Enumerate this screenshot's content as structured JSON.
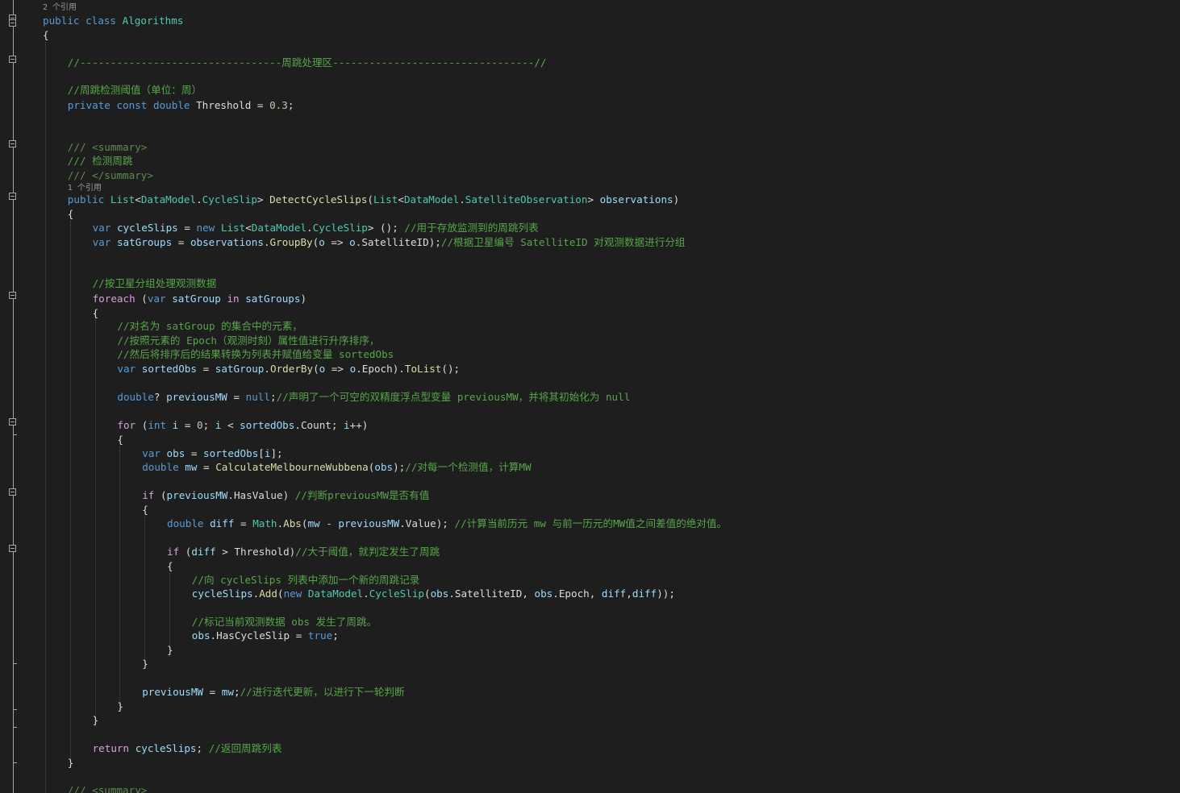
{
  "editor": {
    "codelens": [
      {
        "text": "2 个引用"
      },
      {
        "text": "1 个引用"
      }
    ],
    "lines": [
      {
        "tokens": [
          {
            "t": "public",
            "c": "kw"
          },
          {
            "t": " "
          },
          {
            "t": "class",
            "c": "kw"
          },
          {
            "t": " "
          },
          {
            "t": "Algorithms",
            "c": "typ"
          }
        ]
      },
      {
        "tokens": [
          {
            "t": "{"
          }
        ]
      },
      {
        "tokens": [
          {
            "t": "//---------------------------------周跳处理区---------------------------------//",
            "c": "cm"
          }
        ]
      },
      {
        "tokens": [
          {
            "t": "//周跳检测阈值（单位：周）",
            "c": "cm"
          }
        ]
      },
      {
        "tokens": [
          {
            "t": "private",
            "c": "kw"
          },
          {
            "t": " "
          },
          {
            "t": "const",
            "c": "kw"
          },
          {
            "t": " "
          },
          {
            "t": "double",
            "c": "kw"
          },
          {
            "t": " Threshold = "
          },
          {
            "t": "0.3",
            "c": "num"
          },
          {
            "t": ";"
          }
        ]
      },
      {
        "tokens": [
          {
            "t": "/// <summary>",
            "c": "xml"
          }
        ]
      },
      {
        "tokens": [
          {
            "t": "/// 检测周跳",
            "c": "cm"
          }
        ]
      },
      {
        "tokens": [
          {
            "t": "/// </summary>",
            "c": "xml"
          }
        ]
      },
      {
        "tokens": [
          {
            "t": "public",
            "c": "kw"
          },
          {
            "t": " "
          },
          {
            "t": "List",
            "c": "typ"
          },
          {
            "t": "<"
          },
          {
            "t": "DataModel",
            "c": "typ"
          },
          {
            "t": "."
          },
          {
            "t": "CycleSlip",
            "c": "typ"
          },
          {
            "t": "> "
          },
          {
            "t": "DetectCycleSlips",
            "c": "mth"
          },
          {
            "t": "("
          },
          {
            "t": "List",
            "c": "typ"
          },
          {
            "t": "<"
          },
          {
            "t": "DataModel",
            "c": "typ"
          },
          {
            "t": "."
          },
          {
            "t": "SatelliteObservation",
            "c": "typ"
          },
          {
            "t": "> "
          },
          {
            "t": "observations",
            "c": "vr"
          },
          {
            "t": ")"
          }
        ]
      },
      {
        "tokens": [
          {
            "t": "{"
          }
        ]
      },
      {
        "tokens": [
          {
            "t": "var",
            "c": "kw"
          },
          {
            "t": " "
          },
          {
            "t": "cycleSlips",
            "c": "vr"
          },
          {
            "t": " = "
          },
          {
            "t": "new",
            "c": "kw"
          },
          {
            "t": " "
          },
          {
            "t": "List",
            "c": "typ"
          },
          {
            "t": "<"
          },
          {
            "t": "DataModel",
            "c": "typ"
          },
          {
            "t": "."
          },
          {
            "t": "CycleSlip",
            "c": "typ"
          },
          {
            "t": "> (); "
          },
          {
            "t": "//用于存放监测到的周跳列表",
            "c": "cm"
          }
        ]
      },
      {
        "tokens": [
          {
            "t": "var",
            "c": "kw"
          },
          {
            "t": " "
          },
          {
            "t": "satGroups",
            "c": "vr"
          },
          {
            "t": " = "
          },
          {
            "t": "observations",
            "c": "vr"
          },
          {
            "t": "."
          },
          {
            "t": "GroupBy",
            "c": "mth"
          },
          {
            "t": "("
          },
          {
            "t": "o",
            "c": "vr"
          },
          {
            "t": " => "
          },
          {
            "t": "o",
            "c": "vr"
          },
          {
            "t": ".SatelliteID);"
          },
          {
            "t": "//根据卫星编号 SatelliteID 对观测数据进行分组",
            "c": "cm"
          }
        ]
      },
      {
        "tokens": [
          {
            "t": "//按卫星分组处理观测数据",
            "c": "cm"
          }
        ]
      },
      {
        "tokens": [
          {
            "t": "foreach",
            "c": "ctl"
          },
          {
            "t": " ("
          },
          {
            "t": "var",
            "c": "kw"
          },
          {
            "t": " "
          },
          {
            "t": "satGroup",
            "c": "vr"
          },
          {
            "t": " "
          },
          {
            "t": "in",
            "c": "ctl"
          },
          {
            "t": " "
          },
          {
            "t": "satGroups",
            "c": "vr"
          },
          {
            "t": ")"
          }
        ]
      },
      {
        "tokens": [
          {
            "t": "{"
          }
        ]
      },
      {
        "tokens": [
          {
            "t": "//对名为 satGroup 的集合中的元素，",
            "c": "cm"
          }
        ]
      },
      {
        "tokens": [
          {
            "t": "//按照元素的 Epoch（观测时刻）属性值进行升序排序，",
            "c": "cm"
          }
        ]
      },
      {
        "tokens": [
          {
            "t": "//然后将排序后的结果转换为列表并赋值给变量 sortedObs",
            "c": "cm"
          }
        ]
      },
      {
        "tokens": [
          {
            "t": "var",
            "c": "kw"
          },
          {
            "t": " "
          },
          {
            "t": "sortedObs",
            "c": "vr"
          },
          {
            "t": " = "
          },
          {
            "t": "satGroup",
            "c": "vr"
          },
          {
            "t": "."
          },
          {
            "t": "OrderBy",
            "c": "mth"
          },
          {
            "t": "("
          },
          {
            "t": "o",
            "c": "vr"
          },
          {
            "t": " => "
          },
          {
            "t": "o",
            "c": "vr"
          },
          {
            "t": ".Epoch)."
          },
          {
            "t": "ToList",
            "c": "mth"
          },
          {
            "t": "();"
          }
        ]
      },
      {
        "tokens": [
          {
            "t": "double",
            "c": "kw"
          },
          {
            "t": "? "
          },
          {
            "t": "previousMW",
            "c": "vr"
          },
          {
            "t": " = "
          },
          {
            "t": "null",
            "c": "kw"
          },
          {
            "t": ";"
          },
          {
            "t": "//声明了一个可空的双精度浮点型变量 previousMW，并将其初始化为 null",
            "c": "cm"
          }
        ]
      },
      {
        "tokens": [
          {
            "t": "for",
            "c": "ctl"
          },
          {
            "t": " ("
          },
          {
            "t": "int",
            "c": "kw"
          },
          {
            "t": " "
          },
          {
            "t": "i",
            "c": "vr"
          },
          {
            "t": " = "
          },
          {
            "t": "0",
            "c": "num"
          },
          {
            "t": "; "
          },
          {
            "t": "i",
            "c": "vr"
          },
          {
            "t": " < "
          },
          {
            "t": "sortedObs",
            "c": "vr"
          },
          {
            "t": ".Count; "
          },
          {
            "t": "i",
            "c": "vr"
          },
          {
            "t": "++)"
          }
        ]
      },
      {
        "tokens": [
          {
            "t": "{"
          }
        ]
      },
      {
        "tokens": [
          {
            "t": "var",
            "c": "kw"
          },
          {
            "t": " "
          },
          {
            "t": "obs",
            "c": "vr"
          },
          {
            "t": " = "
          },
          {
            "t": "sortedObs",
            "c": "vr"
          },
          {
            "t": "["
          },
          {
            "t": "i",
            "c": "vr"
          },
          {
            "t": "];"
          }
        ]
      },
      {
        "tokens": [
          {
            "t": "double",
            "c": "kw"
          },
          {
            "t": " "
          },
          {
            "t": "mw",
            "c": "vr"
          },
          {
            "t": " = "
          },
          {
            "t": "CalculateMelbourneWubbena",
            "c": "mth"
          },
          {
            "t": "("
          },
          {
            "t": "obs",
            "c": "vr"
          },
          {
            "t": ");"
          },
          {
            "t": "//对每一个检测值，计算MW",
            "c": "cm"
          }
        ]
      },
      {
        "tokens": [
          {
            "t": "if",
            "c": "ctl"
          },
          {
            "t": " ("
          },
          {
            "t": "previousMW",
            "c": "vr"
          },
          {
            "t": ".HasValue) "
          },
          {
            "t": "//判断previousMW是否有值",
            "c": "cm"
          }
        ]
      },
      {
        "tokens": [
          {
            "t": "{"
          }
        ]
      },
      {
        "tokens": [
          {
            "t": "double",
            "c": "kw"
          },
          {
            "t": " "
          },
          {
            "t": "diff",
            "c": "vr"
          },
          {
            "t": " = "
          },
          {
            "t": "Math",
            "c": "typ"
          },
          {
            "t": "."
          },
          {
            "t": "Abs",
            "c": "mth"
          },
          {
            "t": "("
          },
          {
            "t": "mw",
            "c": "vr"
          },
          {
            "t": " - "
          },
          {
            "t": "previousMW",
            "c": "vr"
          },
          {
            "t": ".Value); "
          },
          {
            "t": "//计算当前历元 mw 与前一历元的MW值之间差值的绝对值。",
            "c": "cm"
          }
        ]
      },
      {
        "tokens": [
          {
            "t": "if",
            "c": "ctl"
          },
          {
            "t": " ("
          },
          {
            "t": "diff",
            "c": "vr"
          },
          {
            "t": " > Threshold)"
          },
          {
            "t": "//大于阈值，就判定发生了周跳",
            "c": "cm"
          }
        ]
      },
      {
        "tokens": [
          {
            "t": "{"
          }
        ]
      },
      {
        "tokens": [
          {
            "t": "//向 cycleSlips 列表中添加一个新的周跳记录",
            "c": "cm"
          }
        ]
      },
      {
        "tokens": [
          {
            "t": "cycleSlips",
            "c": "vr"
          },
          {
            "t": "."
          },
          {
            "t": "Add",
            "c": "mth"
          },
          {
            "t": "("
          },
          {
            "t": "new",
            "c": "kw"
          },
          {
            "t": " "
          },
          {
            "t": "DataModel",
            "c": "typ"
          },
          {
            "t": "."
          },
          {
            "t": "CycleSlip",
            "c": "typ"
          },
          {
            "t": "("
          },
          {
            "t": "obs",
            "c": "vr"
          },
          {
            "t": ".SatelliteID, "
          },
          {
            "t": "obs",
            "c": "vr"
          },
          {
            "t": ".Epoch, "
          },
          {
            "t": "diff",
            "c": "vr"
          },
          {
            "t": ","
          },
          {
            "t": "diff",
            "c": "vr"
          },
          {
            "t": "));"
          }
        ]
      },
      {
        "tokens": [
          {
            "t": "//标记当前观测数据 obs 发生了周跳。",
            "c": "cm"
          }
        ]
      },
      {
        "tokens": [
          {
            "t": "obs",
            "c": "vr"
          },
          {
            "t": ".HasCycleSlip = "
          },
          {
            "t": "true",
            "c": "kw"
          },
          {
            "t": ";"
          }
        ]
      },
      {
        "tokens": [
          {
            "t": "}"
          }
        ]
      },
      {
        "tokens": [
          {
            "t": "}"
          }
        ]
      },
      {
        "tokens": [
          {
            "t": "previousMW",
            "c": "vr"
          },
          {
            "t": " = "
          },
          {
            "t": "mw",
            "c": "vr"
          },
          {
            "t": ";"
          },
          {
            "t": "//进行迭代更新，以进行下一轮判断",
            "c": "cm"
          }
        ]
      },
      {
        "tokens": [
          {
            "t": "}"
          }
        ]
      },
      {
        "tokens": [
          {
            "t": "}"
          }
        ]
      },
      {
        "tokens": [
          {
            "t": "return",
            "c": "ctl"
          },
          {
            "t": " "
          },
          {
            "t": "cycleSlips",
            "c": "vr"
          },
          {
            "t": "; "
          },
          {
            "t": "//返回周跳列表",
            "c": "cm"
          }
        ]
      },
      {
        "tokens": [
          {
            "t": "}"
          }
        ]
      },
      {
        "tokens": [
          {
            "t": "/// <summary>",
            "c": "xml"
          }
        ]
      }
    ]
  }
}
